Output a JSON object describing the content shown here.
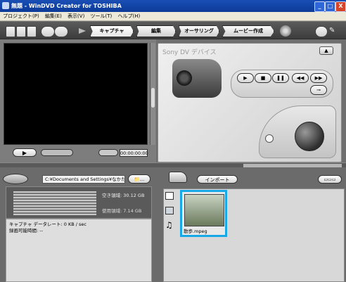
{
  "window": {
    "title": "無題 - WinDVD Creator for TOSHIBA",
    "controls": [
      "_",
      "□",
      "X"
    ]
  },
  "menu": [
    "プロジェクト(P)",
    "編集(E)",
    "表示(V)",
    "ツール(T)",
    "ヘルプ(H)"
  ],
  "modes": [
    "キャプチャ",
    "編集",
    "オーサリング",
    "ムービー作成"
  ],
  "player": {
    "play_symbol": "▶",
    "timecode": "00:00:00:00"
  },
  "device": {
    "title": "Sony DV デバイス",
    "buttons": [
      "▶",
      "■",
      "❚❚",
      "◀◀",
      "▶▶",
      "⊸"
    ]
  },
  "folder": {
    "path": "C:¥Documents and Settings¥なかた",
    "browse_label": "📁..."
  },
  "disk": {
    "free_space": "空き領域: 30.12 GB",
    "used_space": "使用領域: 7.14 GB"
  },
  "capture_info": {
    "rate": "キャプチャ データレート: 0 KB / sec",
    "time": "録画可能時間: --"
  },
  "import": {
    "label": "インポート",
    "view_label": "▭▭▭"
  },
  "media": [
    {
      "name": "散歩.mpeg"
    }
  ],
  "colors": {
    "accent": "#19a8e6",
    "titlebar": "#1a4fb5"
  }
}
